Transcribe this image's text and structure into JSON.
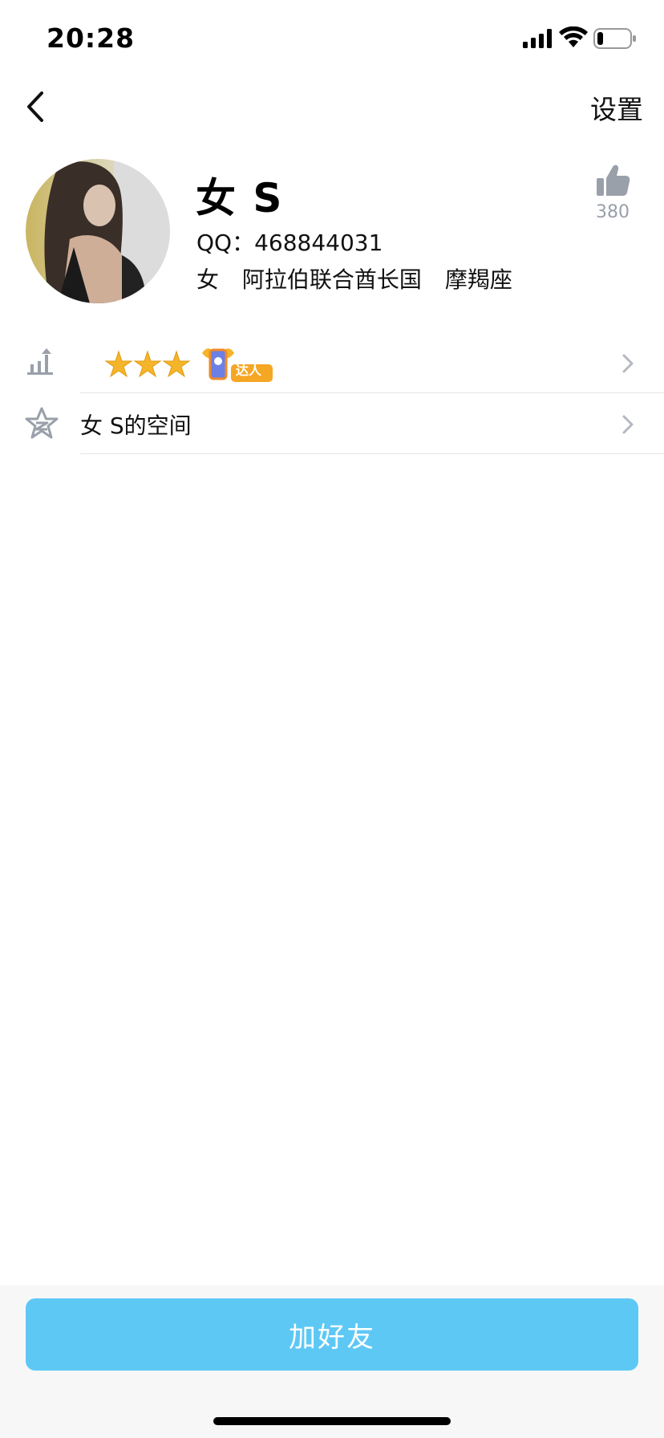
{
  "status_bar": {
    "time": "20:28"
  },
  "nav": {
    "settings_label": "设置"
  },
  "profile": {
    "nickname": "女 S",
    "qq_line": "QQ：468844031",
    "gender": "女",
    "region": "阿拉伯联合酋长国",
    "zodiac": "摩羯座",
    "like_count": "380"
  },
  "rows": {
    "level": {
      "badge_text": "达人"
    },
    "space": {
      "label": "女 S的空间"
    }
  },
  "footer": {
    "add_friend_label": "加好友"
  },
  "colors": {
    "button": "#5ec8f5",
    "accent_icon": "#9aa0aa"
  }
}
